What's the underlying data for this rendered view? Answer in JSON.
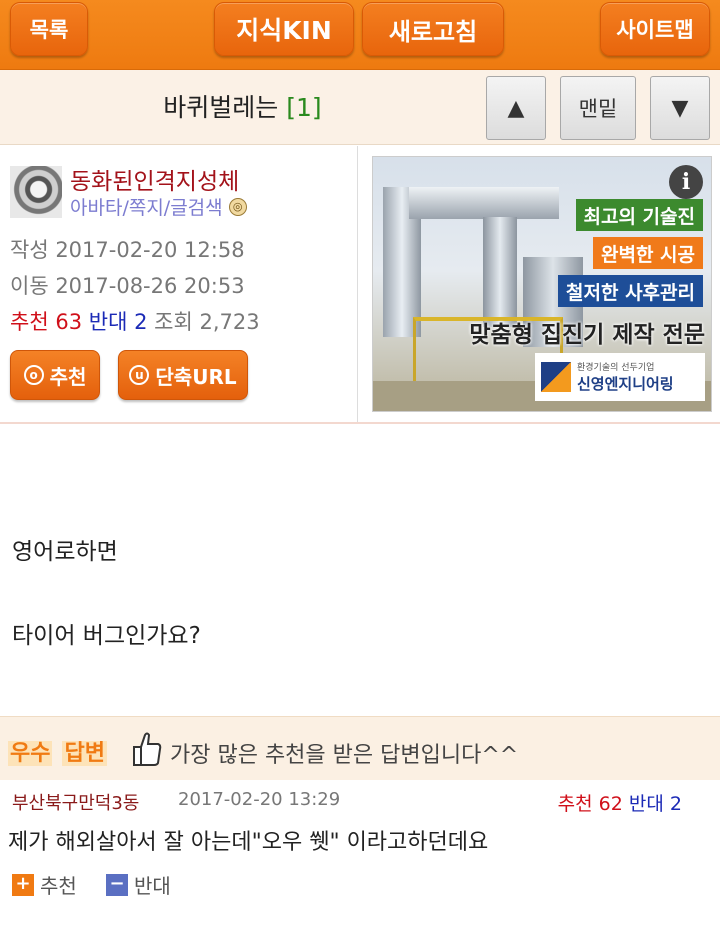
{
  "topbar": {
    "list_label": "목록",
    "kin_label": "지식KIN",
    "refresh_label": "새로고침",
    "sitemap_label": "사이트맵"
  },
  "titlebar": {
    "title": "바퀴벌레는",
    "comment_count": "[1]",
    "up_label": "▲",
    "bottom_label": "맨밑",
    "down_label": "▼"
  },
  "post": {
    "author": "동화된인격지성체",
    "user_links": "아바타/쪽지/글검색",
    "written": "작성 2017-02-20 12:58",
    "moved": "이동 2017-08-26 20:53",
    "recommend_label": "추천",
    "recommend_count": "63",
    "oppose_label": "반대",
    "oppose_count": "2",
    "views_label": "조회",
    "views_count": "2,723",
    "recommend_button": "추천",
    "recommend_button_icon": "o",
    "shorturl_button": "단축URL",
    "shorturl_button_icon": "u",
    "body": [
      "영어로하면",
      "타이어 버그인가요?"
    ]
  },
  "ad": {
    "info_icon": "i",
    "tag1": "최고의 기술진",
    "tag2": "완벽한 시공",
    "tag3": "철저한 사후관리",
    "headline": "맞춤형 집진기 제작 전문",
    "company_sub": "환경기술의 선두기업",
    "company_name": "신영엔지니어링"
  },
  "best": {
    "badge_1": "우수",
    "badge_2": "답변",
    "description": "가장 많은 추천을 받은 답변입니다^^"
  },
  "comment": {
    "author": "부산북구만덕3동",
    "date": "2017-02-20 13:29",
    "recommend_label": "추천",
    "recommend_count": "62",
    "oppose_label": "반대",
    "oppose_count": "2",
    "text": "제가 해외살아서 잘 아는데\"오우 쒯\" 이라고하던데요",
    "up_label": "추천",
    "down_label": "반대",
    "up_icon": "+",
    "down_icon": "−"
  }
}
